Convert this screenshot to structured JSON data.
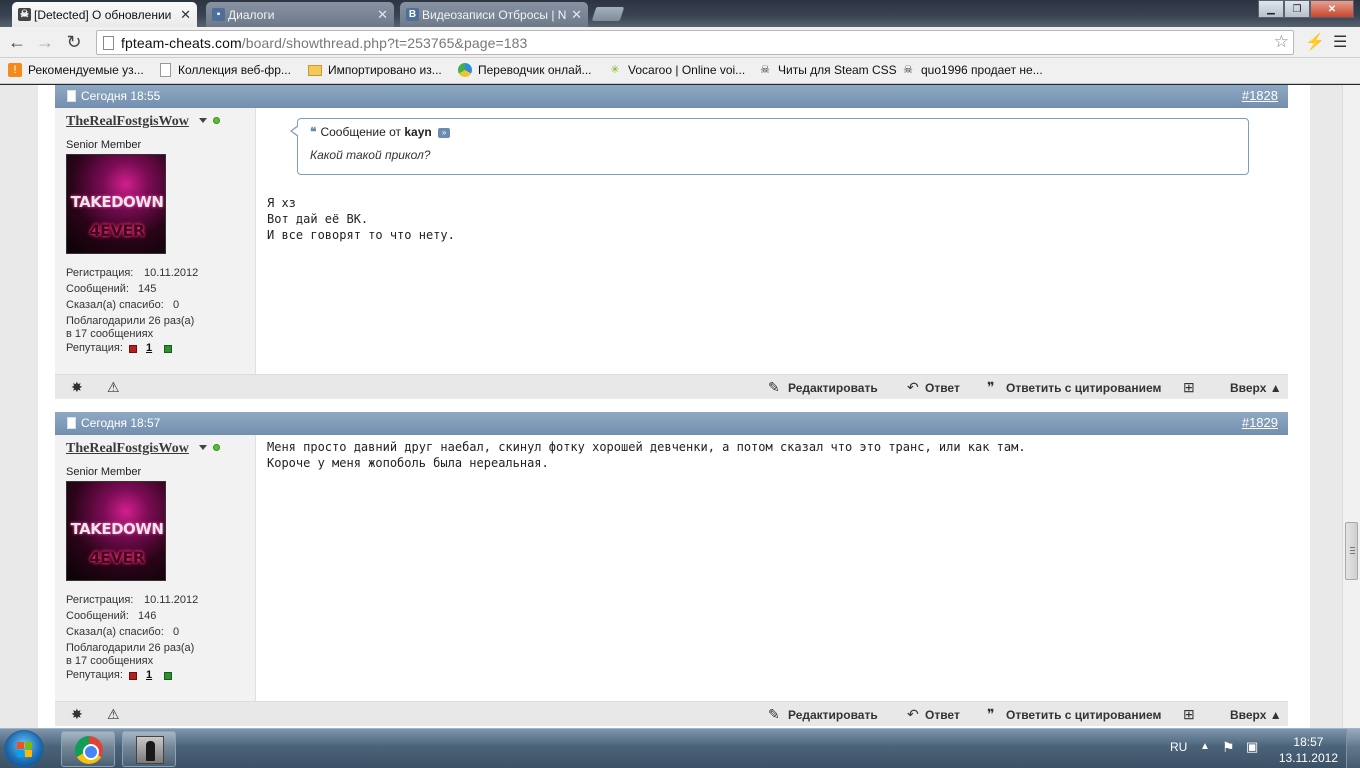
{
  "browser": {
    "tabs": [
      {
        "title": "[Detected] О обновлении",
        "icon": "skull-icon",
        "active": true
      },
      {
        "title": "Диалоги",
        "icon": "vk-dialog-icon",
        "active": false
      },
      {
        "title": "Видеозаписи Отбросы | N",
        "icon": "vk-icon",
        "active": false
      }
    ],
    "url_host": "fpteam-cheats.com",
    "url_path": "/board/showthread.php?t=253765&page=183",
    "bookmarks": [
      {
        "label": "Рекомендуемые уз...",
        "icon": "bookmark-orange-icon"
      },
      {
        "label": "Коллекция веб-фр...",
        "icon": "page-icon"
      },
      {
        "label": "Импортировано из...",
        "icon": "folder-icon"
      },
      {
        "label": "Переводчик онлай...",
        "icon": "translate-icon"
      },
      {
        "label": "Vocaroo | Online voi...",
        "icon": "vocaroo-icon"
      },
      {
        "label": "Читы для Steam CSS",
        "icon": "skull-icon"
      },
      {
        "label": "quo1996 продает не...",
        "icon": "skull-icon"
      }
    ]
  },
  "posts": [
    {
      "date": "Сегодня 18:55",
      "number": "#1828",
      "username": "TheRealFostgisWow",
      "user_title": "Senior Member",
      "avatar_text_top": "TAKEDOWN",
      "avatar_text_bottom": "4EVER",
      "reg_label": "Регистрация:",
      "reg_value": "10.11.2012",
      "msgs_label": "Сообщений:",
      "msgs_value": "145",
      "thanked_label": "Сказал(а) спасибо:",
      "thanked_value": "0",
      "thanks_line1": "Поблагодарили 26 раз(а)",
      "thanks_line2": "в 17 сообщениях",
      "rep_label": "Репутация:",
      "rep_value": "1",
      "quote": {
        "prefix": "Сообщение от",
        "author": "kayn",
        "text": "Какой такой прикол?"
      },
      "body": "Я хз\nВот дай её ВК.\nИ все говорят то что нету."
    },
    {
      "date": "Сегодня 18:57",
      "number": "#1829",
      "username": "TheRealFostgisWow",
      "user_title": "Senior Member",
      "avatar_text_top": "TAKEDOWN",
      "avatar_text_bottom": "4EVER",
      "reg_label": "Регистрация:",
      "reg_value": "10.11.2012",
      "msgs_label": "Сообщений:",
      "msgs_value": "146",
      "thanked_label": "Сказал(а) спасибо:",
      "thanked_value": "0",
      "thanks_line1": "Поблагодарили 26 раз(а)",
      "thanks_line2": "в 17 сообщениях",
      "rep_label": "Репутация:",
      "rep_value": "1",
      "body": "Меня просто давний друг наебал, скинул фотку хорошей девченки, а потом сказал что это транс, или как там.\nКороче у меня жопоболь была нереальная."
    }
  ],
  "footer_actions": {
    "edit": "Редактировать",
    "reply": "Ответ",
    "reply_quote": "Ответить с цитированием",
    "top": "Вверх"
  },
  "taskbar": {
    "language": "RU",
    "time": "18:57",
    "date": "13.11.2012"
  }
}
